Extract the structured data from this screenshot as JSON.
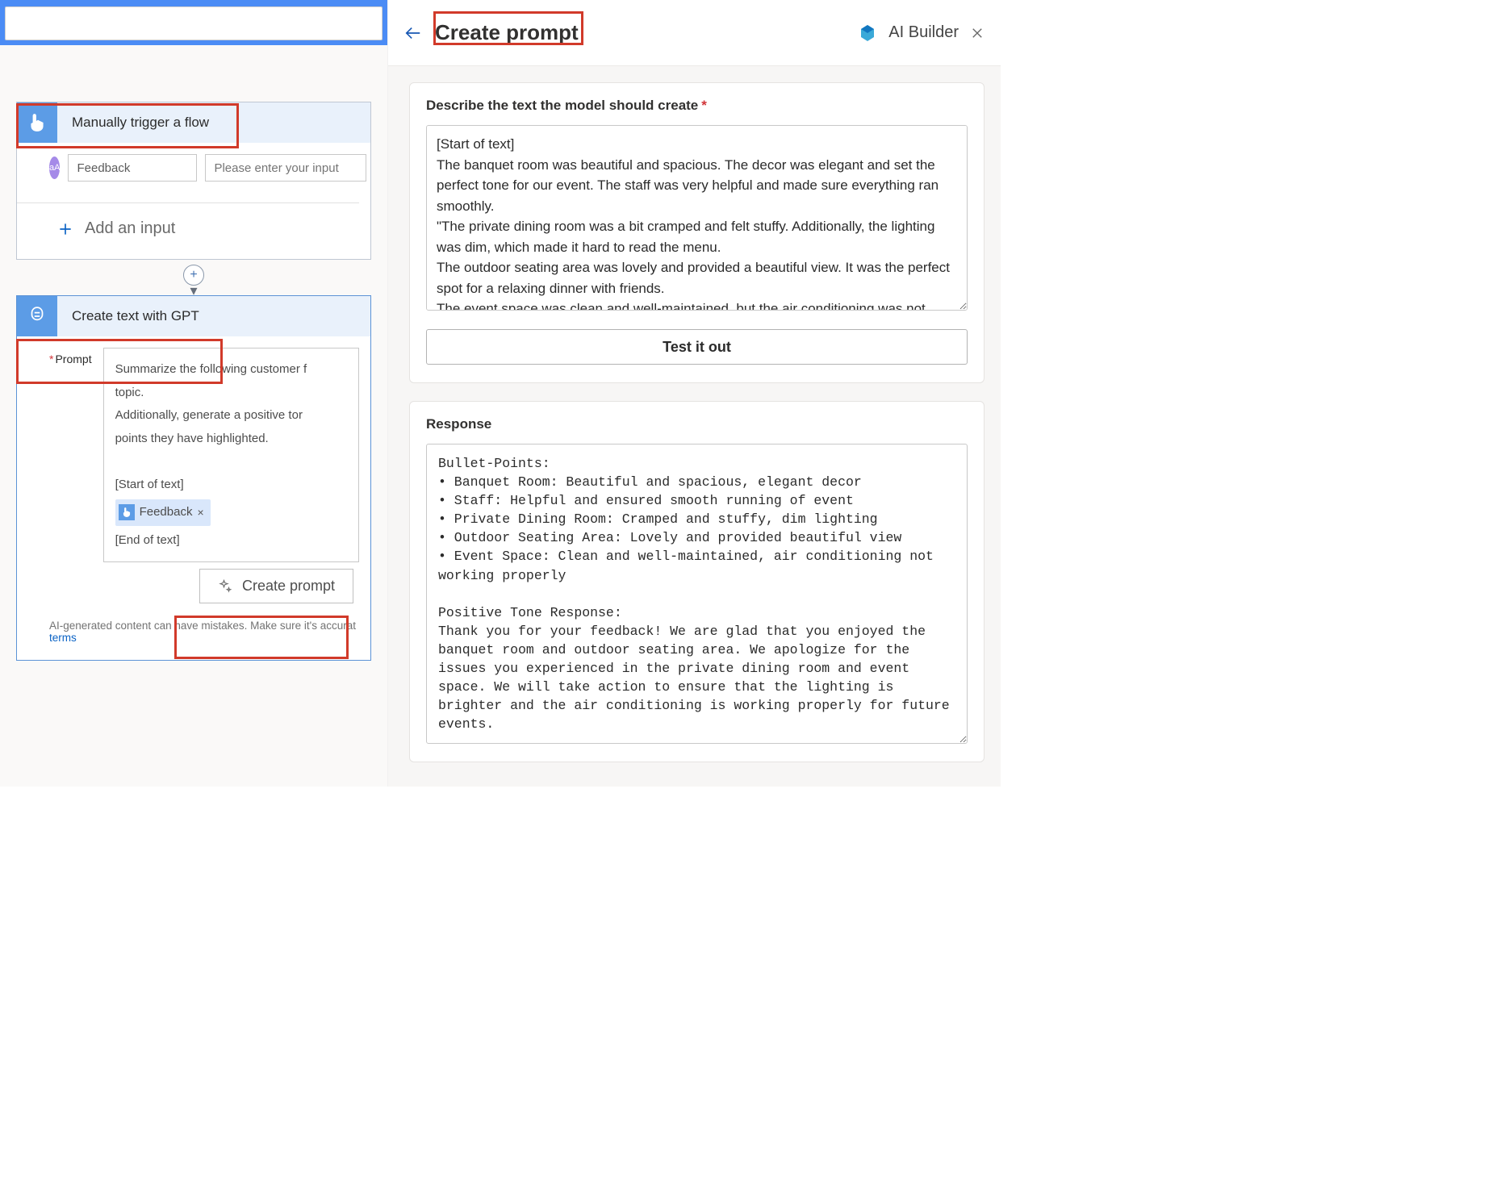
{
  "left": {
    "trigger": {
      "title": "Manually trigger a flow",
      "aa_badge": "aA",
      "param_name": "Feedback",
      "param_placeholder": "Please enter your input",
      "add_input": "Add an input"
    },
    "gpt": {
      "title": "Create text with GPT",
      "prompt_label": "Prompt",
      "prompt_lines": {
        "l1": "Summarize the following customer f",
        "l2": "topic.",
        "l3": "Additionally, generate a positive tor",
        "l4": "points they have highlighted.",
        "start": "[Start of text]",
        "tag": "Feedback",
        "end": "[End of text]"
      },
      "create_prompt_btn": "Create prompt",
      "disclaimer_a": "AI-generated content can have mistakes. Make sure it's accurat",
      "terms_link": "terms"
    }
  },
  "panel": {
    "title": "Create prompt",
    "brand": "AI Builder",
    "describe_label": "Describe the text the model should create",
    "describe_value": "[Start of text]\nThe banquet room was beautiful and spacious. The decor was elegant and set the perfect tone for our event. The staff was very helpful and made sure everything ran smoothly.\n\"The private dining room was a bit cramped and felt stuffy. Additionally, the lighting was dim, which made it hard to read the menu.\nThe outdoor seating area was lovely and provided a beautiful view. It was the perfect spot for a relaxing dinner with friends.\nThe event space was clean and well-maintained, but the air conditioning was not working properly, so it was uncomfortably warm during our event.",
    "test_btn": "Test it out",
    "response_label": "Response",
    "response_value": "Bullet-Points:\n• Banquet Room: Beautiful and spacious, elegant decor\n• Staff: Helpful and ensured smooth running of event\n• Private Dining Room: Cramped and stuffy, dim lighting\n• Outdoor Seating Area: Lovely and provided beautiful view\n• Event Space: Clean and well-maintained, air conditioning not working properly\n\nPositive Tone Response:\nThank you for your feedback! We are glad that you enjoyed the banquet room and outdoor seating area. We apologize for the issues you experienced in the private dining room and event space. We will take action to ensure that the lighting is brighter and the air conditioning is working properly for future events."
  }
}
